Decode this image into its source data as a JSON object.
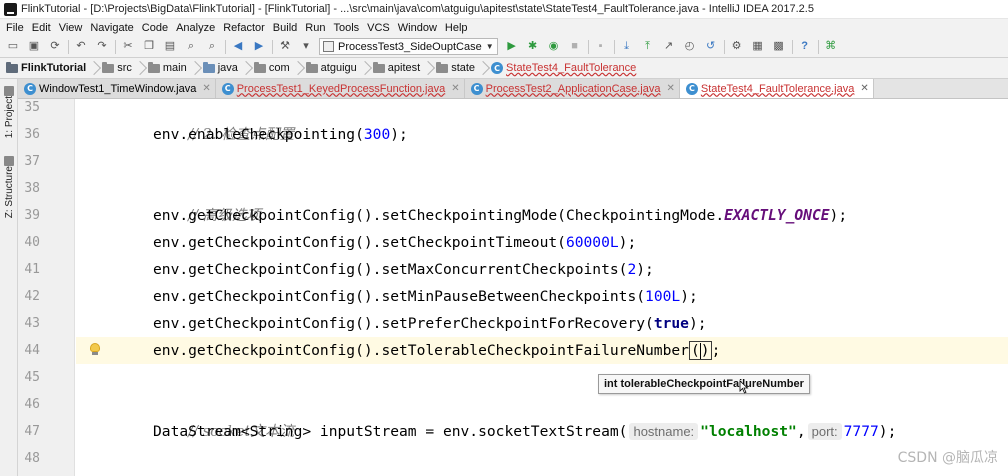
{
  "window": {
    "title": "FlinkTutorial - [D:\\Projects\\BigData\\FlinkTutorial] - [FlinkTutorial] - ...\\src\\main\\java\\com\\atguigu\\apitest\\state\\StateTest4_FaultTolerance.java - IntelliJ IDEA 2017.2.5"
  },
  "menu": [
    "File",
    "Edit",
    "View",
    "Navigate",
    "Code",
    "Analyze",
    "Refactor",
    "Build",
    "Run",
    "Tools",
    "VCS",
    "Window",
    "Help"
  ],
  "toolbar": {
    "run_config": "ProcessTest3_SideOuptCase"
  },
  "breadcrumb": [
    "FlinkTutorial",
    "src",
    "main",
    "java",
    "com",
    "atguigu",
    "apitest",
    "state",
    "StateTest4_FaultTolerance"
  ],
  "tabs": [
    {
      "label": "WindowTest1_TimeWindow.java",
      "active": false,
      "error": false
    },
    {
      "label": "ProcessTest1_KeyedProcessFunction.java",
      "active": false,
      "error": true
    },
    {
      "label": "ProcessTest2_ApplicationCase.java",
      "active": false,
      "error": true
    },
    {
      "label": "StateTest4_FaultTolerance.java",
      "active": true,
      "error": true
    }
  ],
  "tool_windows": {
    "project": "1: Project",
    "structure": "Z: Structure"
  },
  "editor": {
    "line_numbers": [
      "35",
      "36",
      "37",
      "38",
      "39",
      "40",
      "41",
      "42",
      "43",
      "44",
      "45",
      "46",
      "47",
      "48"
    ],
    "lines": {
      "l35": "// 2. 检查点配置",
      "l36_a": "env.enableCheckpointing(",
      "l36_num": "300",
      "l36_b": ");",
      "l38": "// 高级选项",
      "l39_a": "env.getCheckpointConfig().setCheckpointingMode(CheckpointingMode.",
      "l39_field": "EXACTLY_ONCE",
      "l39_b": ");",
      "l40_a": "env.getCheckpointConfig().setCheckpointTimeout(",
      "l40_num": "60000L",
      "l40_b": ");",
      "l41_a": "env.getCheckpointConfig().setMaxConcurrentCheckpoints(",
      "l41_num": "2",
      "l41_b": ");",
      "l42_a": "env.getCheckpointConfig().setMinPauseBetweenCheckpoints(",
      "l42_num": "100L",
      "l42_b": ");",
      "l43_a": "env.getCheckpointConfig().setPreferCheckpointForRecovery(",
      "l43_kw": "true",
      "l43_b": ");",
      "l44_a": "env.getCheckpointConfig().setTolerableCheckpointFailureNumber",
      "l44_paren_open": "(",
      "l44_paren_close": ")",
      "l44_b": ";",
      "l46": "// socket文本流",
      "l47_a": "DataStream<String> inputStream = env.socketTextStream(",
      "l47_hint1": "hostname:",
      "l47_str": "\"localhost\"",
      "l47_comma": ",",
      "l47_hint2": "port:",
      "l47_num": "7777",
      "l47_b": ");"
    }
  },
  "tooltip": {
    "text": "int tolerableCheckpointFailureNumber"
  },
  "watermark": "CSDN @脑瓜凉",
  "colors": {
    "number": "#0000ff",
    "string": "#008000",
    "keyword": "#000080",
    "comment": "#808080",
    "caret_row": "#fffae3",
    "error": "#c83232"
  }
}
